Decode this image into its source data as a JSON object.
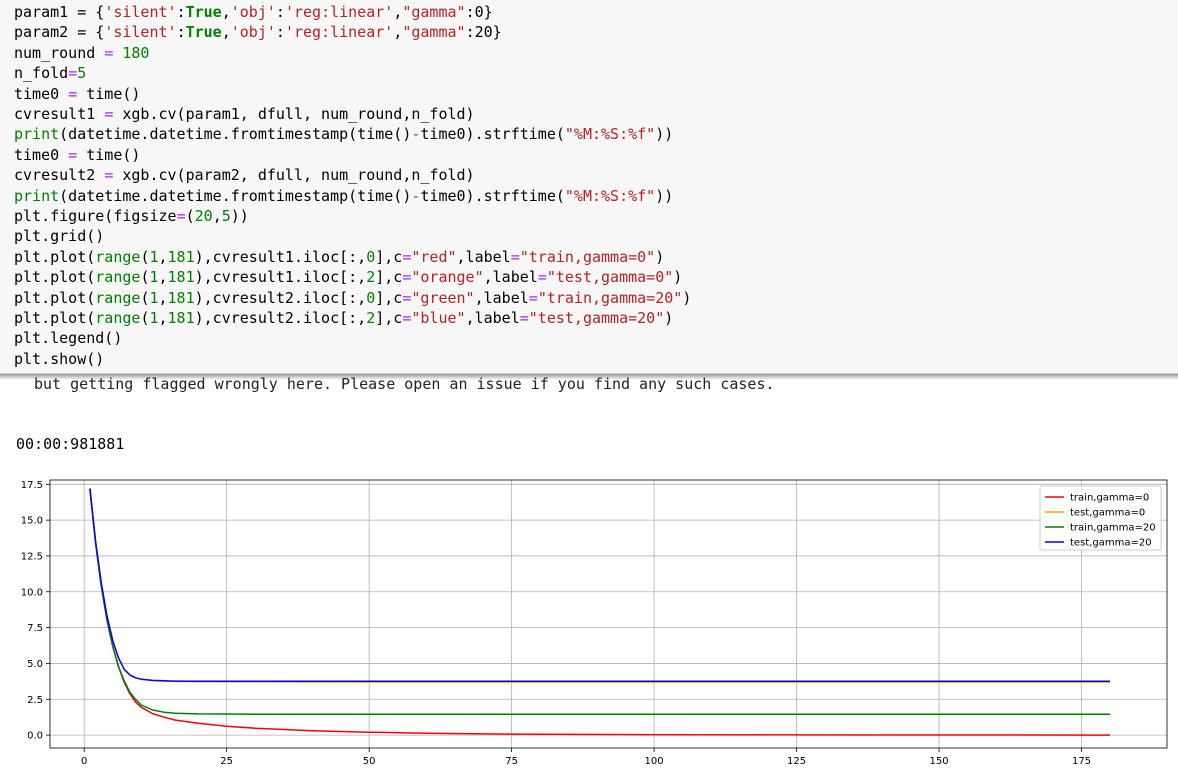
{
  "code_cell": {
    "lines": [
      [
        [
          "param1 = {",
          "p"
        ],
        [
          "'silent'",
          "s"
        ],
        [
          ":",
          "p"
        ],
        [
          "True",
          "k"
        ],
        [
          ",",
          "p"
        ],
        [
          "'obj'",
          "s"
        ],
        [
          ":",
          "p"
        ],
        [
          "'reg:linear'",
          "s"
        ],
        [
          ",",
          "p"
        ],
        [
          "\"gamma\"",
          "s"
        ],
        [
          ":0}",
          "p"
        ]
      ],
      [
        [
          "param2 = {",
          "p"
        ],
        [
          "'silent'",
          "s"
        ],
        [
          ":",
          "p"
        ],
        [
          "True",
          "k"
        ],
        [
          ",",
          "p"
        ],
        [
          "'obj'",
          "s"
        ],
        [
          ":",
          "p"
        ],
        [
          "'reg:linear'",
          "s"
        ],
        [
          ",",
          "p"
        ],
        [
          "\"gamma\"",
          "s"
        ],
        [
          ":20}",
          "p"
        ]
      ],
      [
        [
          "num_round ",
          "p"
        ],
        [
          "=",
          "o"
        ],
        [
          " ",
          "p"
        ],
        [
          "180",
          "n"
        ]
      ],
      [
        [
          "n_fold",
          "p"
        ],
        [
          "=",
          "o"
        ],
        [
          "5",
          "n"
        ]
      ],
      [
        [
          "time0 ",
          "p"
        ],
        [
          "=",
          "o"
        ],
        [
          " time()",
          "p"
        ]
      ],
      [
        [
          "cvresult1 ",
          "p"
        ],
        [
          "=",
          "o"
        ],
        [
          " xgb.cv(param1, dfull, num_round,n_fold)",
          "p"
        ]
      ],
      [
        [
          "print",
          "b"
        ],
        [
          "(datetime.datetime.fromtimestamp(time()",
          "p"
        ],
        [
          "-",
          "o"
        ],
        [
          "time0).strftime(",
          "p"
        ],
        [
          "\"%M:%S:%f\"",
          "s"
        ],
        [
          "))",
          "p"
        ]
      ],
      [
        [
          "time0 ",
          "p"
        ],
        [
          "=",
          "o"
        ],
        [
          " time()",
          "p"
        ]
      ],
      [
        [
          "cvresult2 ",
          "p"
        ],
        [
          "=",
          "o"
        ],
        [
          " xgb.cv(param2, dfull, num_round,n_fold)",
          "p"
        ]
      ],
      [
        [
          "print",
          "b"
        ],
        [
          "(datetime.datetime.fromtimestamp(time()",
          "p"
        ],
        [
          "-",
          "o"
        ],
        [
          "time0).strftime(",
          "p"
        ],
        [
          "\"%M:%S:%f\"",
          "s"
        ],
        [
          "))",
          "p"
        ]
      ],
      [
        [
          "plt.figure(figsize",
          "p"
        ],
        [
          "=",
          "o"
        ],
        [
          "(",
          "p"
        ],
        [
          "20",
          "n"
        ],
        [
          ",",
          "p"
        ],
        [
          "5",
          "n"
        ],
        [
          "))",
          "p"
        ]
      ],
      [
        [
          "plt.grid()",
          "p"
        ]
      ],
      [
        [
          "plt.plot(",
          "p"
        ],
        [
          "range",
          "b"
        ],
        [
          "(",
          "p"
        ],
        [
          "1",
          "n"
        ],
        [
          ",",
          "p"
        ],
        [
          "181",
          "n"
        ],
        [
          "),cvresult1.iloc[:,",
          "p"
        ],
        [
          "0",
          "n"
        ],
        [
          "],c",
          "p"
        ],
        [
          "=",
          "o"
        ],
        [
          "\"red\"",
          "s"
        ],
        [
          ",label",
          "p"
        ],
        [
          "=",
          "o"
        ],
        [
          "\"train,gamma=0\"",
          "s"
        ],
        [
          ")",
          "p"
        ]
      ],
      [
        [
          "plt.plot(",
          "p"
        ],
        [
          "range",
          "b"
        ],
        [
          "(",
          "p"
        ],
        [
          "1",
          "n"
        ],
        [
          ",",
          "p"
        ],
        [
          "181",
          "n"
        ],
        [
          "),cvresult1.iloc[:,",
          "p"
        ],
        [
          "2",
          "n"
        ],
        [
          "],c",
          "p"
        ],
        [
          "=",
          "o"
        ],
        [
          "\"orange\"",
          "s"
        ],
        [
          ",label",
          "p"
        ],
        [
          "=",
          "o"
        ],
        [
          "\"test,gamma=0\"",
          "s"
        ],
        [
          ")",
          "p"
        ]
      ],
      [
        [
          "plt.plot(",
          "p"
        ],
        [
          "range",
          "b"
        ],
        [
          "(",
          "p"
        ],
        [
          "1",
          "n"
        ],
        [
          ",",
          "p"
        ],
        [
          "181",
          "n"
        ],
        [
          "),cvresult2.iloc[:,",
          "p"
        ],
        [
          "0",
          "n"
        ],
        [
          "],c",
          "p"
        ],
        [
          "=",
          "o"
        ],
        [
          "\"green\"",
          "s"
        ],
        [
          ",label",
          "p"
        ],
        [
          "=",
          "o"
        ],
        [
          "\"train,gamma=20\"",
          "s"
        ],
        [
          ")",
          "p"
        ]
      ],
      [
        [
          "plt.plot(",
          "p"
        ],
        [
          "range",
          "b"
        ],
        [
          "(",
          "p"
        ],
        [
          "1",
          "n"
        ],
        [
          ",",
          "p"
        ],
        [
          "181",
          "n"
        ],
        [
          "),cvresult2.iloc[:,",
          "p"
        ],
        [
          "2",
          "n"
        ],
        [
          "],c",
          "p"
        ],
        [
          "=",
          "o"
        ],
        [
          "\"blue\"",
          "s"
        ],
        [
          ",label",
          "p"
        ],
        [
          "=",
          "o"
        ],
        [
          "\"test,gamma=20\"",
          "s"
        ],
        [
          ")",
          "p"
        ]
      ],
      [
        [
          "plt.legend()",
          "p"
        ]
      ],
      [
        [
          "plt.show()",
          "p"
        ]
      ]
    ]
  },
  "output": {
    "warning_text": "but getting flagged wrongly here. Please open an issue if you find any such cases.",
    "stdout_text": "00:00:981881"
  },
  "chart_data": {
    "type": "line",
    "title": "",
    "xlabel": "",
    "ylabel": "",
    "xlim": [
      -6,
      190
    ],
    "ylim": [
      -0.9,
      17.8
    ],
    "x_ticks": [
      0,
      25,
      50,
      75,
      100,
      125,
      150,
      175
    ],
    "y_ticks": [
      0.0,
      2.5,
      5.0,
      7.5,
      10.0,
      12.5,
      15.0,
      17.5
    ],
    "y_tick_labels": [
      "0.0",
      "2.5",
      "5.0",
      "7.5",
      "10.0",
      "12.5",
      "15.0",
      "17.5"
    ],
    "grid": true,
    "legend_position": "top-right",
    "series": [
      {
        "name": "train,gamma=0",
        "color": "#ff0000",
        "x": [
          1,
          2,
          3,
          4,
          5,
          6,
          7,
          8,
          9,
          10,
          12,
          14,
          16,
          20,
          25,
          30,
          40,
          50,
          60,
          75,
          100,
          125,
          150,
          180
        ],
        "y": [
          17.2,
          13.4,
          10.4,
          8.0,
          6.2,
          4.8,
          3.7,
          2.9,
          2.3,
          1.95,
          1.5,
          1.25,
          1.05,
          0.82,
          0.62,
          0.48,
          0.3,
          0.2,
          0.13,
          0.07,
          0.03,
          0.015,
          0.008,
          0.0
        ]
      },
      {
        "name": "test,gamma=0",
        "color": "#ffa500",
        "x": [
          1,
          2,
          3,
          4,
          5,
          6,
          7,
          8,
          9,
          10,
          12,
          14,
          16,
          20,
          30,
          50,
          75,
          100,
          125,
          150,
          180
        ],
        "y": [
          17.2,
          13.5,
          10.6,
          8.3,
          6.6,
          5.4,
          4.6,
          4.2,
          4.0,
          3.9,
          3.8,
          3.76,
          3.74,
          3.72,
          3.71,
          3.7,
          3.7,
          3.7,
          3.7,
          3.7,
          3.7
        ]
      },
      {
        "name": "train,gamma=20",
        "color": "#008000",
        "x": [
          1,
          2,
          3,
          4,
          5,
          6,
          7,
          8,
          9,
          10,
          12,
          14,
          16,
          20,
          25,
          30,
          50,
          75,
          100,
          125,
          150,
          180
        ],
        "y": [
          17.2,
          13.4,
          10.4,
          8.0,
          6.2,
          4.8,
          3.8,
          3.0,
          2.5,
          2.1,
          1.75,
          1.6,
          1.52,
          1.48,
          1.47,
          1.46,
          1.46,
          1.46,
          1.46,
          1.46,
          1.46,
          1.46
        ]
      },
      {
        "name": "test,gamma=20",
        "color": "#0000ff",
        "x": [
          1,
          2,
          3,
          4,
          5,
          6,
          7,
          8,
          9,
          10,
          12,
          14,
          16,
          20,
          30,
          50,
          75,
          100,
          125,
          150,
          180
        ],
        "y": [
          17.2,
          13.5,
          10.6,
          8.3,
          6.6,
          5.4,
          4.6,
          4.2,
          4.0,
          3.9,
          3.82,
          3.79,
          3.77,
          3.76,
          3.76,
          3.76,
          3.76,
          3.76,
          3.76,
          3.76,
          3.76
        ]
      }
    ]
  }
}
